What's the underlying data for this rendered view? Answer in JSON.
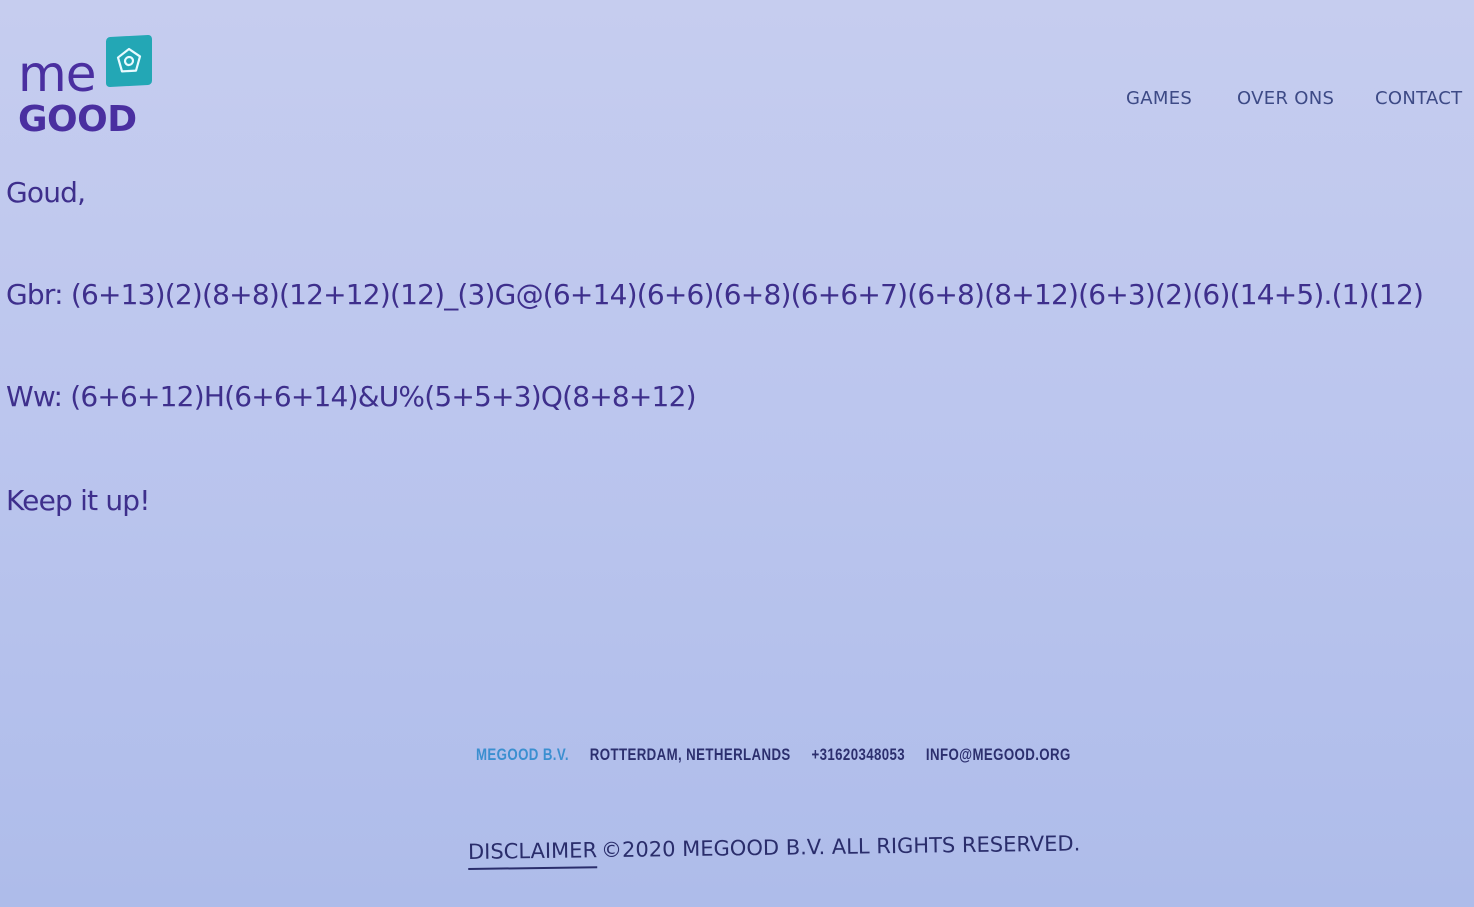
{
  "logo": {
    "me": "me",
    "good": "GOOD",
    "brand_color": "#4a2fa0",
    "mark_color": "#23a7b5",
    "mark_icon": "house-icon"
  },
  "nav": {
    "items": [
      {
        "label": "GAMES"
      },
      {
        "label": "OVER ONS"
      },
      {
        "label": "CONTACT"
      }
    ]
  },
  "message": {
    "greeting": "Goud,",
    "gbr": "Gbr: (6+13)(2)(8+8)(12+12)(12)_(3)G@(6+14)(6+6)(6+8)(6+6+7)(6+8)(8+12)(6+3)(2)(6)(14+5).(1)(12)",
    "ww": "Ww: (6+6+12)H(6+6+14)&U%(5+5+3)Q(8+8+12)",
    "closing": "Keep it up!"
  },
  "footer": {
    "company": "MEGOOD B.V.",
    "city": "ROTTERDAM, NETHERLANDS",
    "phone": "+31620348053",
    "email": "INFO@MEGOOD.ORG",
    "disclaimer": "DISCLAIMER",
    "copyright": "©2020 MEGOOD B.V. ALL RIGHTS RESERVED."
  }
}
